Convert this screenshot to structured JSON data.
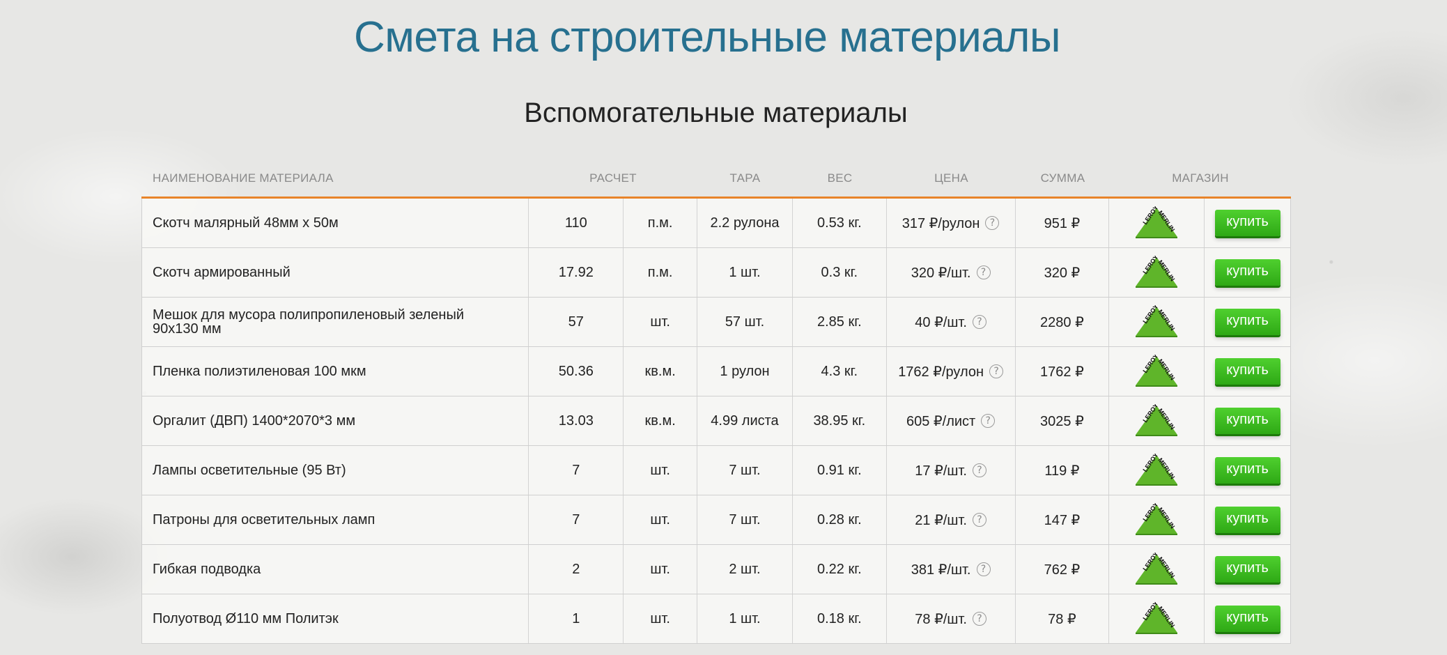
{
  "page": {
    "title": "Смета на строительные материалы",
    "section_title": "Вспомогательные материалы"
  },
  "table": {
    "headers": {
      "name": "НАИМЕНОВАНИЕ МАТЕРИАЛА",
      "calc": "РАСЧЕТ",
      "tara": "ТАРА",
      "weight": "ВЕС",
      "price": "ЦЕНА",
      "sum": "СУММА",
      "shop": "МАГАЗИН"
    },
    "buy_label": "купить",
    "help_glyph": "?",
    "shop_logo": "leroy-merlin-logo",
    "rows": [
      {
        "name": "Скотч малярный 48мм х 50м",
        "qty": "110",
        "unit": "п.м.",
        "tara": "2.2 рулона",
        "weight": "0.53 кг.",
        "price": "317 ₽/рулон",
        "sum": "951 ₽"
      },
      {
        "name": "Скотч армированный",
        "qty": "17.92",
        "unit": "п.м.",
        "tara": "1 шт.",
        "weight": "0.3 кг.",
        "price": "320 ₽/шт.",
        "sum": "320 ₽"
      },
      {
        "name": "Мешок для мусора полипропиленовый зеленый 90х130 мм",
        "qty": "57",
        "unit": "шт.",
        "tara": "57 шт.",
        "weight": "2.85 кг.",
        "price": "40 ₽/шт.",
        "sum": "2280 ₽"
      },
      {
        "name": "Пленка полиэтиленовая 100 мкм",
        "qty": "50.36",
        "unit": "кв.м.",
        "tara": "1 рулон",
        "weight": "4.3 кг.",
        "price": "1762 ₽/рулон",
        "sum": "1762 ₽"
      },
      {
        "name": "Оргалит (ДВП) 1400*2070*3 мм",
        "qty": "13.03",
        "unit": "кв.м.",
        "tara": "4.99 листа",
        "weight": "38.95 кг.",
        "price": "605 ₽/лист",
        "sum": "3025 ₽"
      },
      {
        "name": "Лампы осветительные (95 Вт)",
        "qty": "7",
        "unit": "шт.",
        "tara": "7 шт.",
        "weight": "0.91 кг.",
        "price": "17 ₽/шт.",
        "sum": "119 ₽"
      },
      {
        "name": "Патроны для осветительных ламп",
        "qty": "7",
        "unit": "шт.",
        "tara": "7 шт.",
        "weight": "0.28 кг.",
        "price": "21 ₽/шт.",
        "sum": "147 ₽"
      },
      {
        "name": "Гибкая подводка",
        "qty": "2",
        "unit": "шт.",
        "tara": "2 шт.",
        "weight": "0.22 кг.",
        "price": "381 ₽/шт.",
        "sum": "762 ₽"
      },
      {
        "name": "Полуотвод Ø110 мм Политэк",
        "qty": "1",
        "unit": "шт.",
        "tara": "1 шт.",
        "weight": "0.18 кг.",
        "price": "78 ₽/шт.",
        "sum": "78 ₽"
      }
    ]
  },
  "colors": {
    "title": "#27708f",
    "header_rule": "#e8842a",
    "buy_button": "#35b51c",
    "logo_green": "#5fb52a"
  }
}
